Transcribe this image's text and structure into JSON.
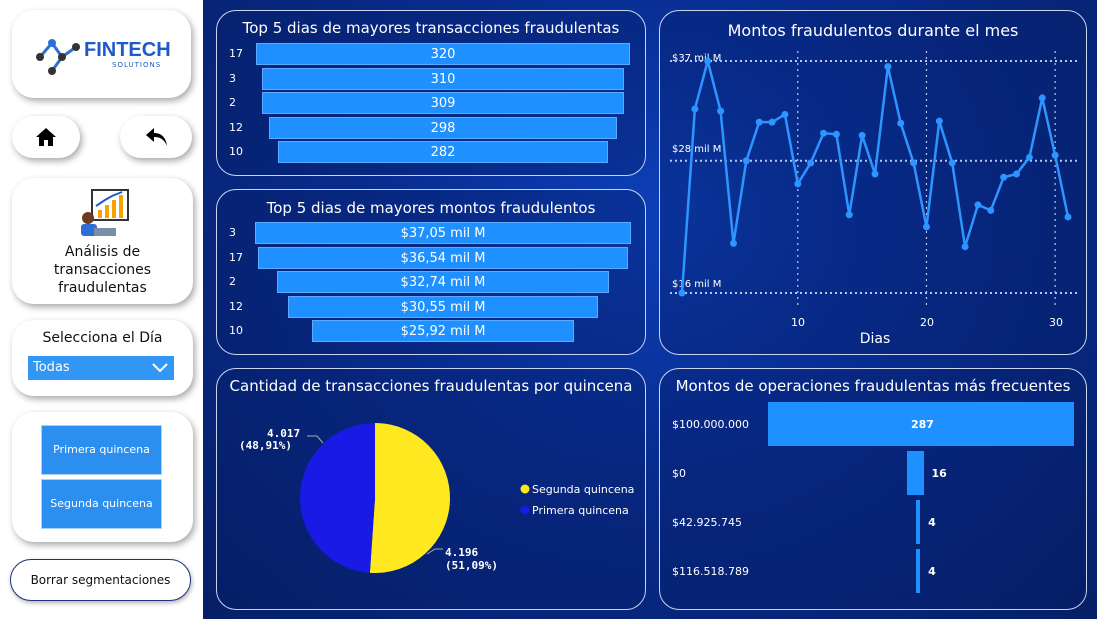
{
  "logo": {
    "brand": "FINTECH",
    "sub": "SOLUTIONS"
  },
  "nav": {
    "home_icon": "home-icon",
    "back_icon": "back-arrow-icon"
  },
  "report": {
    "label": "Análisis de transacciones fraudulentas",
    "line1": "Análisis de",
    "line2": "transacciones",
    "line3": "fraudulentas"
  },
  "day_filter": {
    "label": "Selecciona el Día",
    "selected": "Todas"
  },
  "quincena": {
    "first": "Primera quincena",
    "second": "Segunda quincena"
  },
  "clear_button": "Borrar segmentaciones",
  "colors": {
    "accent": "#1e90ff",
    "yellow": "#ffe81f",
    "darkblue": "#1a1ae6"
  },
  "top_tx": {
    "title": "Top 5 dias de mayores transacciones fraudulentas",
    "rows": [
      {
        "day": "17",
        "value": "320",
        "v": 320
      },
      {
        "day": "3",
        "value": "310",
        "v": 310
      },
      {
        "day": "2",
        "value": "309",
        "v": 309
      },
      {
        "day": "12",
        "value": "298",
        "v": 298
      },
      {
        "day": "10",
        "value": "282",
        "v": 282
      }
    ]
  },
  "top_amt": {
    "title": "Top 5 dias de mayores montos fraudulentos",
    "rows": [
      {
        "day": "3",
        "value": "$37,05 mil M",
        "v": 37.05
      },
      {
        "day": "17",
        "value": "$36,54 mil M",
        "v": 36.54
      },
      {
        "day": "2",
        "value": "$32,74 mil M",
        "v": 32.74
      },
      {
        "day": "12",
        "value": "$30,55 mil M",
        "v": 30.55
      },
      {
        "day": "10",
        "value": "$25,92 mil M",
        "v": 25.92
      }
    ]
  },
  "line_chart": {
    "title": "Montos fraudulentos durante el mes",
    "xlabel": "Dias",
    "y_refs": [
      "$37 mil M",
      "$28 mil M",
      "$16 mil M"
    ],
    "x_ticks": [
      "10",
      "20",
      "30"
    ]
  },
  "pie": {
    "title": "Cantidad de transacciones fraudulentas por quincena",
    "primera_value": "4.017",
    "primera_pct": "(48,91%)",
    "segunda_value": "4.196",
    "segunda_pct": "(51,09%)",
    "legend_segunda": "Segunda quincena",
    "legend_primera": "Primera quincena"
  },
  "freq": {
    "title": "Montos de operaciones fraudulentas más frecuentes",
    "rows": [
      {
        "label": "$100.000.000",
        "value": "287",
        "v": 287
      },
      {
        "label": "$0",
        "value": "16",
        "v": 16
      },
      {
        "label": "$42.925.745",
        "value": "4",
        "v": 4
      },
      {
        "label": "$116.518.789",
        "value": "4",
        "v": 4
      }
    ]
  },
  "chart_data": [
    {
      "type": "bar",
      "title": "Top 5 dias de mayores transacciones fraudulentas",
      "categories": [
        "17",
        "3",
        "2",
        "12",
        "10"
      ],
      "values": [
        320,
        310,
        309,
        298,
        282
      ]
    },
    {
      "type": "bar",
      "title": "Top 5 dias de mayores montos fraudulentos",
      "categories": [
        "3",
        "17",
        "2",
        "12",
        "10"
      ],
      "values": [
        37.05,
        36.54,
        32.74,
        30.55,
        25.92
      ]
    },
    {
      "type": "line",
      "title": "Montos fraudulentos durante el mes",
      "xlabel": "Dias",
      "x": [
        1,
        2,
        3,
        4,
        5,
        6,
        7,
        8,
        9,
        10,
        11,
        12,
        13,
        14,
        15,
        16,
        17,
        18,
        19,
        20,
        21,
        22,
        23,
        24,
        25,
        26,
        27,
        28,
        29,
        30,
        31
      ],
      "y": [
        16.0,
        32.7,
        37.05,
        32.5,
        20.5,
        28.0,
        31.5,
        31.5,
        32.2,
        25.9,
        27.8,
        30.5,
        30.4,
        23.1,
        30.3,
        26.8,
        36.54,
        31.4,
        27.8,
        22.0,
        31.6,
        27.8,
        20.2,
        24.0,
        23.5,
        26.5,
        26.8,
        28.3,
        33.7,
        28.5,
        22.9
      ],
      "xlim": [
        1,
        31
      ],
      "ylim": [
        15.5,
        38
      ]
    },
    {
      "type": "pie",
      "title": "Cantidad de transacciones fraudulentas por quincena",
      "categories": [
        "Segunda quincena",
        "Primera quincena"
      ],
      "values": [
        4196,
        4017
      ]
    },
    {
      "type": "bar",
      "title": "Montos de operaciones fraudulentas más frecuentes",
      "categories": [
        "$100.000.000",
        "$0",
        "$42.925.745",
        "$116.518.789"
      ],
      "values": [
        287,
        16,
        4,
        4
      ]
    }
  ]
}
